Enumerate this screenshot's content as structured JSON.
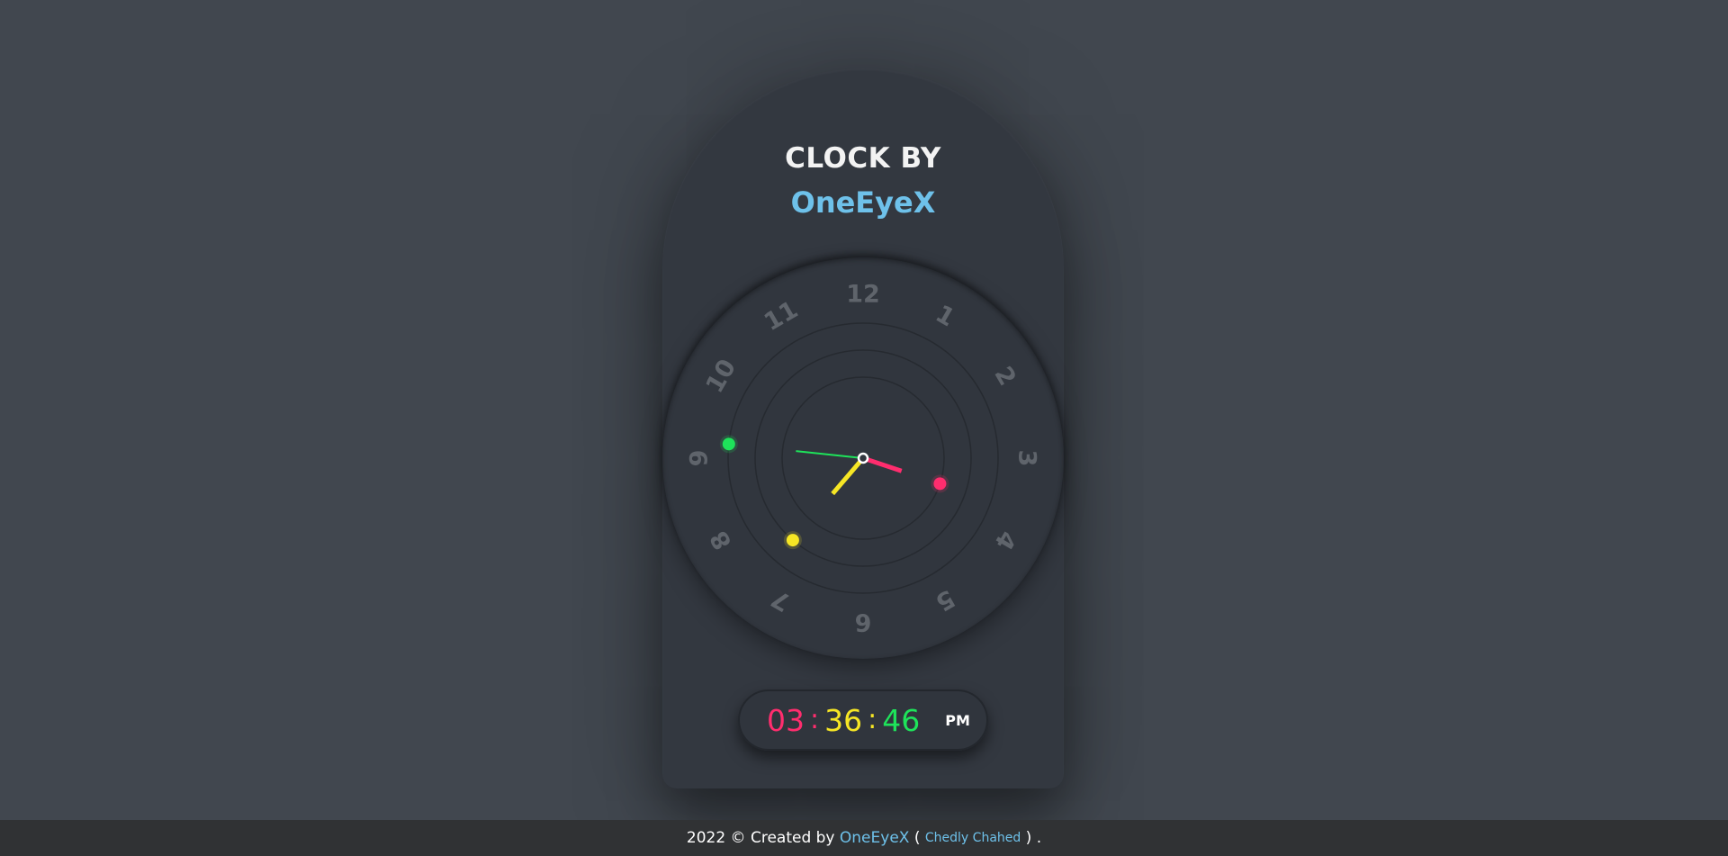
{
  "header": {
    "line1": "CLOCK BY",
    "line2": "OneEyeX"
  },
  "clock": {
    "numbers": [
      "12",
      "1",
      "2",
      "3",
      "4",
      "5",
      "6",
      "7",
      "8",
      "9",
      "10",
      "11"
    ],
    "time": {
      "hours": 3,
      "minutes": 36,
      "seconds": 46
    },
    "colors": {
      "hour": "#ff2d6e",
      "minute": "#f6e625",
      "second": "#1ee35a",
      "center": "#ffffff"
    }
  },
  "digital": {
    "hours": "03",
    "minutes": "36",
    "seconds": "46",
    "sep": ":",
    "ampm": "PM"
  },
  "footer": {
    "prefix": "2022 © Created by ",
    "brand": "OneEyeX",
    "open": " ( ",
    "author": "Chedly Chahed",
    "close": " ) ."
  }
}
